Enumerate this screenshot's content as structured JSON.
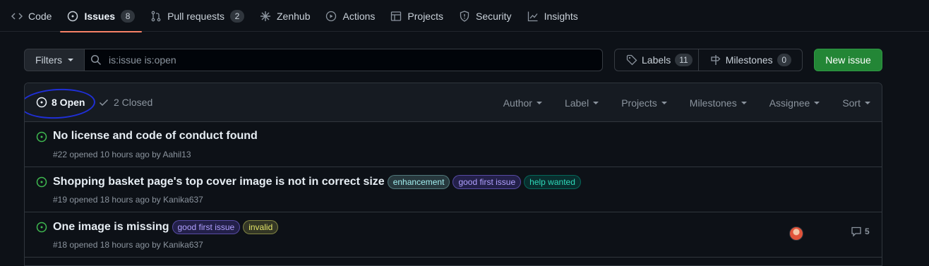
{
  "nav": {
    "tabs": [
      {
        "label": "Code",
        "icon": "code-icon"
      },
      {
        "label": "Issues",
        "icon": "issue-opened-icon",
        "count": "8"
      },
      {
        "label": "Pull requests",
        "icon": "git-pull-request-icon",
        "count": "2"
      },
      {
        "label": "Zenhub",
        "icon": "zenhub-icon"
      },
      {
        "label": "Actions",
        "icon": "play-icon"
      },
      {
        "label": "Projects",
        "icon": "table-icon"
      },
      {
        "label": "Security",
        "icon": "shield-icon"
      },
      {
        "label": "Insights",
        "icon": "graph-icon"
      }
    ]
  },
  "toolbar": {
    "filters_label": "Filters",
    "search_value": "is:issue is:open",
    "labels_label": "Labels",
    "labels_count": "11",
    "milestones_label": "Milestones",
    "milestones_count": "0",
    "new_issue_label": "New issue"
  },
  "list_header": {
    "open_label": "8 Open",
    "closed_label": "2 Closed",
    "filters": [
      "Author",
      "Label",
      "Projects",
      "Milestones",
      "Assignee",
      "Sort"
    ]
  },
  "issues": [
    {
      "title": "No license and code of conduct found",
      "meta": "#22 opened 10 hours ago by Aahil13",
      "labels": []
    },
    {
      "title": "Shopping basket page's top cover image is not in correct size",
      "meta": "#19 opened 18 hours ago by Kanika637",
      "labels": [
        "enhancement",
        "good first issue",
        "help wanted"
      ]
    },
    {
      "title": "One image is missing",
      "meta": "#18 opened 18 hours ago by Kanika637",
      "labels": [
        "good first issue",
        "invalid"
      ],
      "comments": "5"
    }
  ],
  "colors": {
    "background": "#0d1117",
    "open_icon": "#3fb950",
    "accent_underline": "#f78166",
    "new_issue_button": "#238636",
    "annotation_circle": "#1f2fd6",
    "label_enhancement": "#a2eeef",
    "label_good_first_issue": "#7057ff",
    "label_help_wanted": "#008672",
    "label_invalid": "#e4e669"
  }
}
